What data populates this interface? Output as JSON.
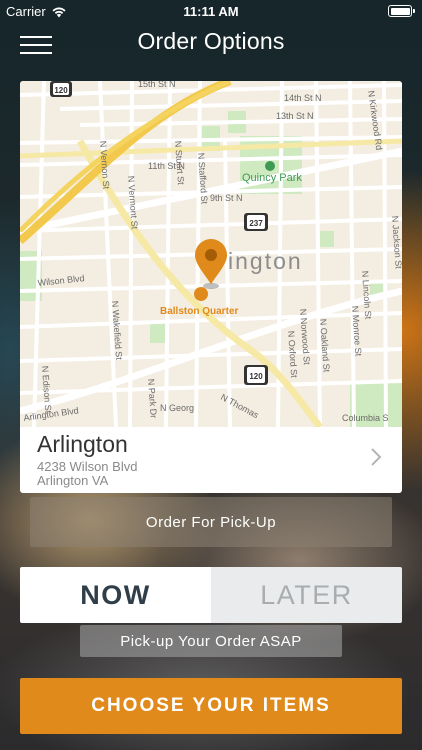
{
  "status": {
    "carrier": "Carrier",
    "time": "11:11 AM",
    "wifi_icon": "wifi-icon",
    "battery_icon": "battery-icon"
  },
  "nav": {
    "title": "Order Options",
    "menu_icon": "hamburger-menu-icon"
  },
  "map": {
    "labels": {
      "s15": "15th St N",
      "s14": "14th St N",
      "s13": "13th St N",
      "s11": "11th St N",
      "s9": "9th St N",
      "quincy": "Quincy Park",
      "ington": "ington",
      "ballston": "Ballston Quarter",
      "kirkwood": "N Kirkwood Rd",
      "vernon": "N Vernon St",
      "vermont": "N Vermont St",
      "stuart": "N Stuart St",
      "stafford": "N Stafford St",
      "wakefield": "N Wakefield St",
      "edison": "N Edison St",
      "park": "N Park Dr",
      "george": "N Georg",
      "thomas": "N Thomas",
      "norwood": "N Norwood St",
      "oxford": "N Oxford St",
      "oakland": "N Oakland St",
      "monroe": "N Monroe St",
      "lincoln": "N Lincoln St",
      "jackson": "N Jackson St",
      "wilson": "Wilson Blvd",
      "arlington_blvd": "Arlington Blvd",
      "route_120a": "120",
      "route_237": "237",
      "route_120b": "120",
      "columbia": "Columbia S"
    }
  },
  "location": {
    "name": "Arlington",
    "address_line1": "4238 Wilson Blvd",
    "address_line2": "Arlington VA",
    "chevron_icon": "chevron-right-icon"
  },
  "order_mode": "Order For Pick-Up",
  "timing": {
    "now": "NOW",
    "later": "LATER",
    "selected": "NOW",
    "hint": "Pick-up Your Order ASAP"
  },
  "cta": "CHOOSE YOUR ITEMS",
  "colors": {
    "accent": "#e08a1c",
    "map_pin": "#e08a1c",
    "park_green": "#bfe3b0"
  }
}
